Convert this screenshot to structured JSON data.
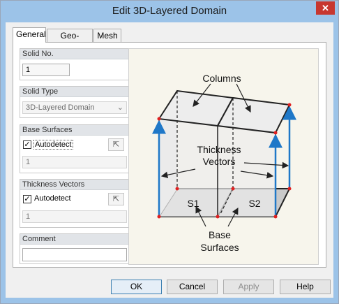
{
  "window": {
    "title": "Edit 3D-Layered Domain",
    "close_glyph": "✕"
  },
  "tabs": [
    {
      "label": "General",
      "active": true
    },
    {
      "label": "Geo-Layers",
      "active": false
    },
    {
      "label": "Mesh",
      "active": false
    }
  ],
  "solid_no": {
    "header": "Solid No.",
    "value": "1"
  },
  "solid_type": {
    "header": "Solid Type",
    "value": "3D-Layered Domain"
  },
  "base_surfaces": {
    "header": "Base Surfaces",
    "checkbox_label": "Autodetect",
    "checked": true,
    "value": "1"
  },
  "thickness_vectors": {
    "header": "Thickness Vectors",
    "checkbox_label": "Autodetect",
    "checked": true,
    "value": "1"
  },
  "comment": {
    "header": "Comment",
    "value": ""
  },
  "diagram": {
    "columns_label": "Columns",
    "thickness_label_1": "Thickness",
    "thickness_label_2": "Vectors",
    "s1_label": "S1",
    "s2_label": "S2",
    "base_label_1": "Base",
    "base_label_2": "Surfaces",
    "colors": {
      "vector": "#1f78c8",
      "node": "#e02020",
      "base_fill": "#c9c9c9",
      "column_fill": "#ebebeb"
    }
  },
  "buttons": {
    "ok": "OK",
    "cancel": "Cancel",
    "apply": "Apply",
    "help": "Help"
  }
}
